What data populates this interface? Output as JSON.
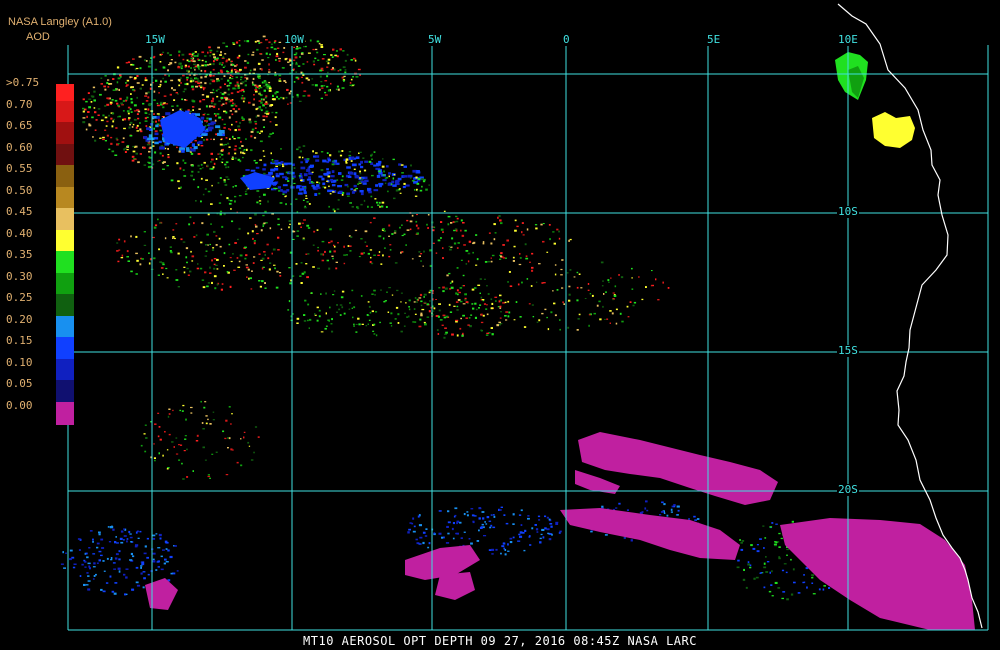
{
  "header": {
    "title": "NASA Langley (A1.0)",
    "subtitle": "AOD"
  },
  "legend": {
    "items": [
      {
        "label": ">0.75",
        "color": "#ff2020"
      },
      {
        "label": "0.70",
        "color": "#d81818"
      },
      {
        "label": "0.65",
        "color": "#a01010"
      },
      {
        "label": "0.60",
        "color": "#701010"
      },
      {
        "label": "0.55",
        "color": "#8a6010"
      },
      {
        "label": "0.50",
        "color": "#b88820"
      },
      {
        "label": "0.45",
        "color": "#e8c060"
      },
      {
        "label": "0.40",
        "color": "#ffff30"
      },
      {
        "label": "0.35",
        "color": "#20e020"
      },
      {
        "label": "0.30",
        "color": "#10a010"
      },
      {
        "label": "0.25",
        "color": "#106010"
      },
      {
        "label": "0.20",
        "color": "#1890f0"
      },
      {
        "label": "0.15",
        "color": "#1040ff"
      },
      {
        "label": "0.10",
        "color": "#1020c0"
      },
      {
        "label": "0.05",
        "color": "#101070"
      },
      {
        "label": "0.00",
        "color": "#c020a0"
      }
    ]
  },
  "map": {
    "lon_labels": [
      "15W",
      "10W",
      "5W",
      "0",
      "5E",
      "10E"
    ],
    "lat_labels": [
      "10S",
      "15S",
      "20S"
    ],
    "grid_color": "#40e0e0",
    "coast_color": "#ffffff"
  },
  "footer": {
    "text": "MT10  AEROSOL OPT DEPTH   09 27, 2016 08:45Z   NASA LARC"
  }
}
